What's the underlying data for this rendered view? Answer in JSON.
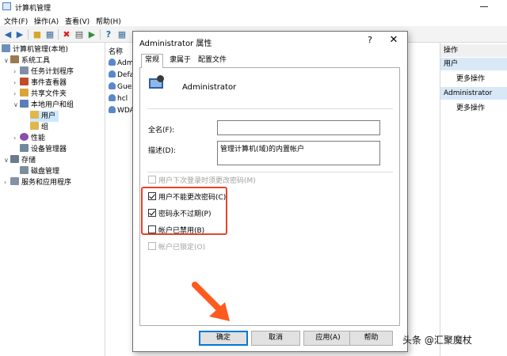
{
  "window": {
    "title": "计算机管理"
  },
  "menu": [
    "文件(F)",
    "操作(A)",
    "查看(V)",
    "帮助(H)"
  ],
  "toolbar": {
    "icons": [
      "back-arrow-icon",
      "forward-arrow-icon",
      "folder-up-icon",
      "show-hide-tree-icon",
      "delete-icon",
      "properties-icon",
      "export-list-icon",
      "help-icon",
      "show-hide-action-pane-icon"
    ]
  },
  "tree": {
    "root": "计算机管理(本地)",
    "system_tools": "系统工具",
    "task_scheduler": "任务计划程序",
    "event_viewer": "事件查看器",
    "shared_folders": "共享文件夹",
    "local_users_groups": "本地用户和组",
    "users": "用户",
    "groups": "组",
    "performance": "性能",
    "device_manager": "设备管理器",
    "storage": "存储",
    "disk_management": "磁盘管理",
    "services_apps": "服务和应用程序"
  },
  "list": {
    "header": "名称",
    "rows": [
      "Admi",
      "Defa",
      "Gues",
      "hcl",
      "WDA"
    ]
  },
  "actions": {
    "header": "操作",
    "section1": "用户",
    "section1_more": "更多操作",
    "section2": "Administrator",
    "section2_more": "更多操作"
  },
  "dialog": {
    "title": "Administrator 属性",
    "help": "?",
    "close": "✕",
    "tabs": [
      "常规",
      "隶属于",
      "配置文件"
    ],
    "username": "Administrator",
    "fullname_label": "全名(F):",
    "fullname_value": "",
    "description_label": "描述(D):",
    "description_value": "管理计算机(域)的内置帐户",
    "checkboxes": [
      {
        "label": "用户下次登录时须更改密码(M)",
        "checked": false,
        "disabled": true
      },
      {
        "label": "用户不能更改密码(C)",
        "checked": true,
        "disabled": false
      },
      {
        "label": "密码永不过期(P)",
        "checked": true,
        "disabled": false
      },
      {
        "label": "帐户已禁用(B)",
        "checked": false,
        "disabled": false
      },
      {
        "label": "帐户已锁定(O)",
        "checked": false,
        "disabled": true
      }
    ],
    "buttons": {
      "ok": "确定",
      "cancel": "取消",
      "apply": "应用(A)",
      "help": "帮助"
    }
  },
  "annotation": {
    "highlight_color": "#e4442b",
    "arrow_color": "#ff5a1f"
  },
  "watermark": "头条 @汇聚魔杖"
}
